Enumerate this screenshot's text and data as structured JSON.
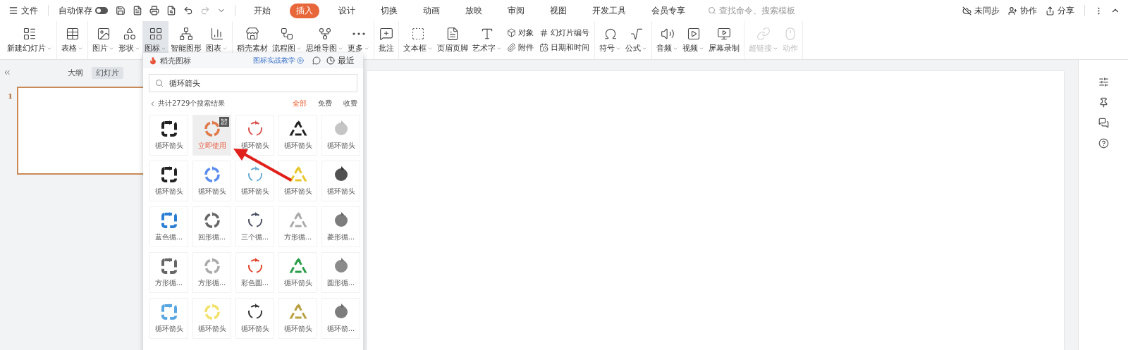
{
  "top_bar": {
    "file_menu": "文件",
    "autosave": {
      "label": "自动保存",
      "on": false
    },
    "tabs": [
      {
        "label": "开始",
        "selected": false
      },
      {
        "label": "插入",
        "selected": true
      },
      {
        "label": "设计",
        "selected": false
      },
      {
        "label": "切换",
        "selected": false
      },
      {
        "label": "动画",
        "selected": false
      },
      {
        "label": "放映",
        "selected": false
      },
      {
        "label": "审阅",
        "selected": false
      },
      {
        "label": "视图",
        "selected": false
      },
      {
        "label": "开发工具",
        "selected": false
      },
      {
        "label": "会员专享",
        "selected": false
      }
    ],
    "search": {
      "placeholder": "查找命令、搜索模板"
    },
    "actions": [
      "未同步",
      "协作",
      "分享"
    ]
  },
  "ribbon": {
    "groups": [
      [
        {
          "kind": "large",
          "label": "新建幻灯片",
          "has_menu": true,
          "selected": false,
          "disabled": false
        }
      ],
      [
        {
          "kind": "large",
          "label": "表格",
          "has_menu": true,
          "selected": false,
          "disabled": false
        }
      ],
      [
        {
          "kind": "large",
          "label": "图片",
          "has_menu": true,
          "selected": false,
          "disabled": false
        },
        {
          "kind": "large",
          "label": "形状",
          "has_menu": true,
          "selected": false,
          "disabled": false
        },
        {
          "kind": "large",
          "label": "图标",
          "has_menu": true,
          "selected": true,
          "disabled": false
        },
        {
          "kind": "large",
          "label": "智能图形",
          "has_menu": false,
          "selected": false,
          "disabled": false
        },
        {
          "kind": "large",
          "label": "图表",
          "has_menu": true,
          "selected": false,
          "disabled": false
        }
      ],
      [
        {
          "kind": "large",
          "label": "稻壳素材",
          "has_menu": false,
          "selected": false,
          "disabled": false
        },
        {
          "kind": "large",
          "label": "流程图",
          "has_menu": true,
          "selected": false,
          "disabled": false
        },
        {
          "kind": "large",
          "label": "思维导图",
          "has_menu": true,
          "selected": false,
          "disabled": false
        },
        {
          "kind": "large",
          "label": "更多",
          "has_menu": true,
          "selected": false,
          "disabled": false
        }
      ],
      [
        {
          "kind": "large",
          "label": "批注",
          "has_menu": false,
          "selected": false,
          "disabled": false
        }
      ],
      [
        {
          "kind": "large",
          "label": "文本框",
          "has_menu": true,
          "selected": false,
          "disabled": false
        },
        {
          "kind": "large",
          "label": "页眉页脚",
          "has_menu": false,
          "selected": false,
          "disabled": false
        },
        {
          "kind": "large",
          "label": "艺术字",
          "has_menu": true,
          "selected": false,
          "disabled": false
        },
        {
          "kind": "pair",
          "items": [
            "对象",
            "附件"
          ]
        },
        {
          "kind": "pair",
          "items": [
            "幻灯片编号",
            "日期和时间"
          ]
        }
      ],
      [
        {
          "kind": "large",
          "label": "符号",
          "has_menu": true,
          "selected": false,
          "disabled": false
        },
        {
          "kind": "large",
          "label": "公式",
          "has_menu": true,
          "selected": false,
          "disabled": false
        }
      ],
      [
        {
          "kind": "large",
          "label": "音频",
          "has_menu": true,
          "selected": false,
          "disabled": false
        },
        {
          "kind": "large",
          "label": "视频",
          "has_menu": true,
          "selected": false,
          "disabled": false
        },
        {
          "kind": "large",
          "label": "屏幕录制",
          "has_menu": false,
          "selected": false,
          "disabled": false
        }
      ],
      [
        {
          "kind": "large",
          "label": "超链接",
          "has_menu": true,
          "selected": false,
          "disabled": true
        },
        {
          "kind": "large",
          "label": "动作",
          "has_menu": false,
          "selected": false,
          "disabled": true
        }
      ]
    ]
  },
  "left_panel": {
    "tabs": [
      {
        "label": "大纲",
        "selected": false
      },
      {
        "label": "幻灯片",
        "selected": true
      }
    ],
    "slides": [
      {
        "number": "1",
        "selected": true
      }
    ]
  },
  "icon_panel": {
    "title": "稻壳图标",
    "tutorial_link": "图标实战教学",
    "recent": "最近",
    "search": {
      "value": "循环箭头"
    },
    "result_count": "共计2729个搜索结果",
    "filters": [
      {
        "label": "全部",
        "selected": true
      },
      {
        "label": "免费",
        "selected": false
      },
      {
        "label": "收费",
        "selected": false
      }
    ],
    "items": [
      {
        "label": "循环箭头",
        "hovered": false
      },
      {
        "label": "立即使用",
        "hovered": true
      },
      {
        "label": "循环箭头",
        "hovered": false
      },
      {
        "label": "循环箭头",
        "hovered": false
      },
      {
        "label": "循环箭头",
        "hovered": false
      },
      {
        "label": "循环箭头",
        "hovered": false
      },
      {
        "label": "循环箭头",
        "hovered": false
      },
      {
        "label": "循环箭头",
        "hovered": false
      },
      {
        "label": "循环箭头",
        "hovered": false
      },
      {
        "label": "循环箭头",
        "hovered": false
      },
      {
        "label": "蓝色循...",
        "hovered": false
      },
      {
        "label": "回形循...",
        "hovered": false
      },
      {
        "label": "三个循...",
        "hovered": false
      },
      {
        "label": "方形循...",
        "hovered": false
      },
      {
        "label": "菱形循...",
        "hovered": false
      },
      {
        "label": "方形循...",
        "hovered": false
      },
      {
        "label": "方形循...",
        "hovered": false
      },
      {
        "label": "彩色圆...",
        "hovered": false
      },
      {
        "label": "循环箭头",
        "hovered": false
      },
      {
        "label": "圆形循...",
        "hovered": false
      },
      {
        "label": "循环箭头",
        "hovered": false
      },
      {
        "label": "循环箭头",
        "hovered": false
      },
      {
        "label": "循环箭头",
        "hovered": false
      },
      {
        "label": "循环箭头",
        "hovered": false
      },
      {
        "label": "循环箭...",
        "hovered": false
      }
    ]
  }
}
